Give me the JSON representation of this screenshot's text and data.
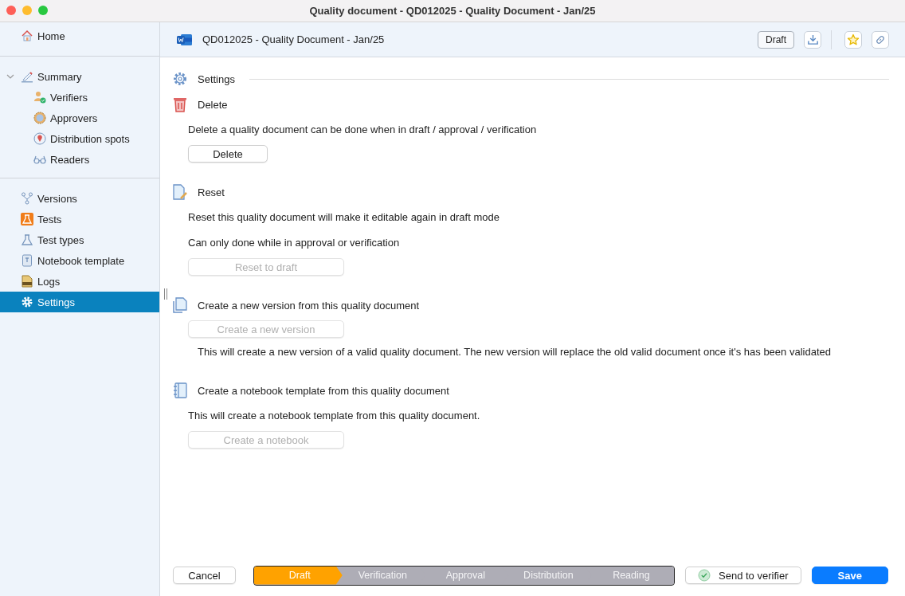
{
  "window": {
    "title": "Quality document - QD012025 - Quality Document - Jan/25"
  },
  "sidebar": {
    "groups": [
      {
        "items": [
          {
            "label": "Home",
            "selected": false
          }
        ]
      },
      {
        "items": [
          {
            "label": "Summary",
            "selected": false,
            "expanded": true,
            "children": [
              {
                "label": "Verifiers",
                "selected": false
              },
              {
                "label": "Approvers",
                "selected": false
              },
              {
                "label": "Distribution spots",
                "selected": false
              },
              {
                "label": "Readers",
                "selected": false
              }
            ]
          }
        ]
      },
      {
        "items": [
          {
            "label": "Versions",
            "selected": false
          },
          {
            "label": "Tests",
            "selected": false
          },
          {
            "label": "Test types",
            "selected": false
          },
          {
            "label": "Notebook template",
            "selected": false
          },
          {
            "label": "Logs",
            "selected": false
          },
          {
            "label": "Settings",
            "selected": true
          }
        ]
      }
    ]
  },
  "header": {
    "title": "QD012025 - Quality Document - Jan/25",
    "status_badge": "Draft"
  },
  "settings_title": "Settings",
  "sections": [
    {
      "title": "Delete",
      "blocks": [
        {
          "kind": "text",
          "text": "Delete a quality document can be done when in draft / approval / verification"
        },
        {
          "kind": "button",
          "text": "Delete",
          "disabled": false
        }
      ]
    },
    {
      "title": "Reset",
      "blocks": [
        {
          "kind": "text",
          "text": "Reset this quality document will make it editable again in draft mode"
        },
        {
          "kind": "text",
          "text": "Can only done while in approval or verification"
        },
        {
          "kind": "button",
          "text": "Reset to draft",
          "disabled": true
        }
      ]
    },
    {
      "title": "Create a new version from this quality document",
      "blocks": [
        {
          "kind": "button",
          "text": "Create a new version",
          "disabled": true
        },
        {
          "kind": "note",
          "text": "This will create a new version of a valid quality document. The new version will replace the old valid document once it's has been validated"
        }
      ]
    },
    {
      "title": "Create a notebook template from this quality document",
      "blocks": [
        {
          "kind": "text",
          "text": "This will create a notebook template from this quality document."
        },
        {
          "kind": "button",
          "text": "Create a notebook",
          "disabled": true
        }
      ]
    }
  ],
  "footer": {
    "cancel": "Cancel",
    "steps": [
      {
        "label": "Draft",
        "selected": true
      },
      {
        "label": "Verification",
        "selected": false
      },
      {
        "label": "Approval",
        "selected": false
      },
      {
        "label": "Distribution",
        "selected": false
      },
      {
        "label": "Reading",
        "selected": false
      }
    ],
    "send": "Send to verifier",
    "save": "Save"
  }
}
